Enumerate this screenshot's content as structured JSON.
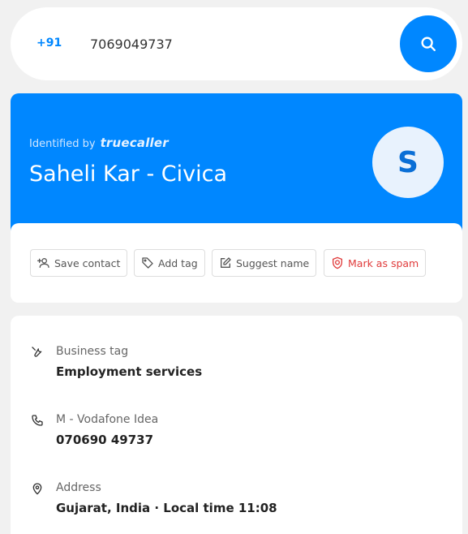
{
  "search": {
    "country_code": "+91",
    "value": "7069049737",
    "button_icon": "search-icon"
  },
  "identity": {
    "identified_by": "Identified by",
    "brand": "truecaller",
    "name": "Saheli Kar - Civica",
    "avatar_initial": "S",
    "header_color": "#0087ff"
  },
  "actions": [
    {
      "label": "Save contact",
      "icon": "add-person-icon"
    },
    {
      "label": "Add tag",
      "icon": "tag-icon"
    },
    {
      "label": "Suggest name",
      "icon": "edit-icon"
    },
    {
      "label": "Mark as spam",
      "icon": "spam-shield-icon",
      "color": "#e03b3b"
    }
  ],
  "details": [
    {
      "label": "Business tag",
      "value": "Employment services",
      "icon": "wrench-icon"
    },
    {
      "label": "M - Vodafone Idea",
      "value": "070690 49737",
      "icon": "phone-icon"
    },
    {
      "label": "Address",
      "value": "Gujarat, India · Local time 11:08",
      "icon": "location-pin-icon"
    }
  ]
}
